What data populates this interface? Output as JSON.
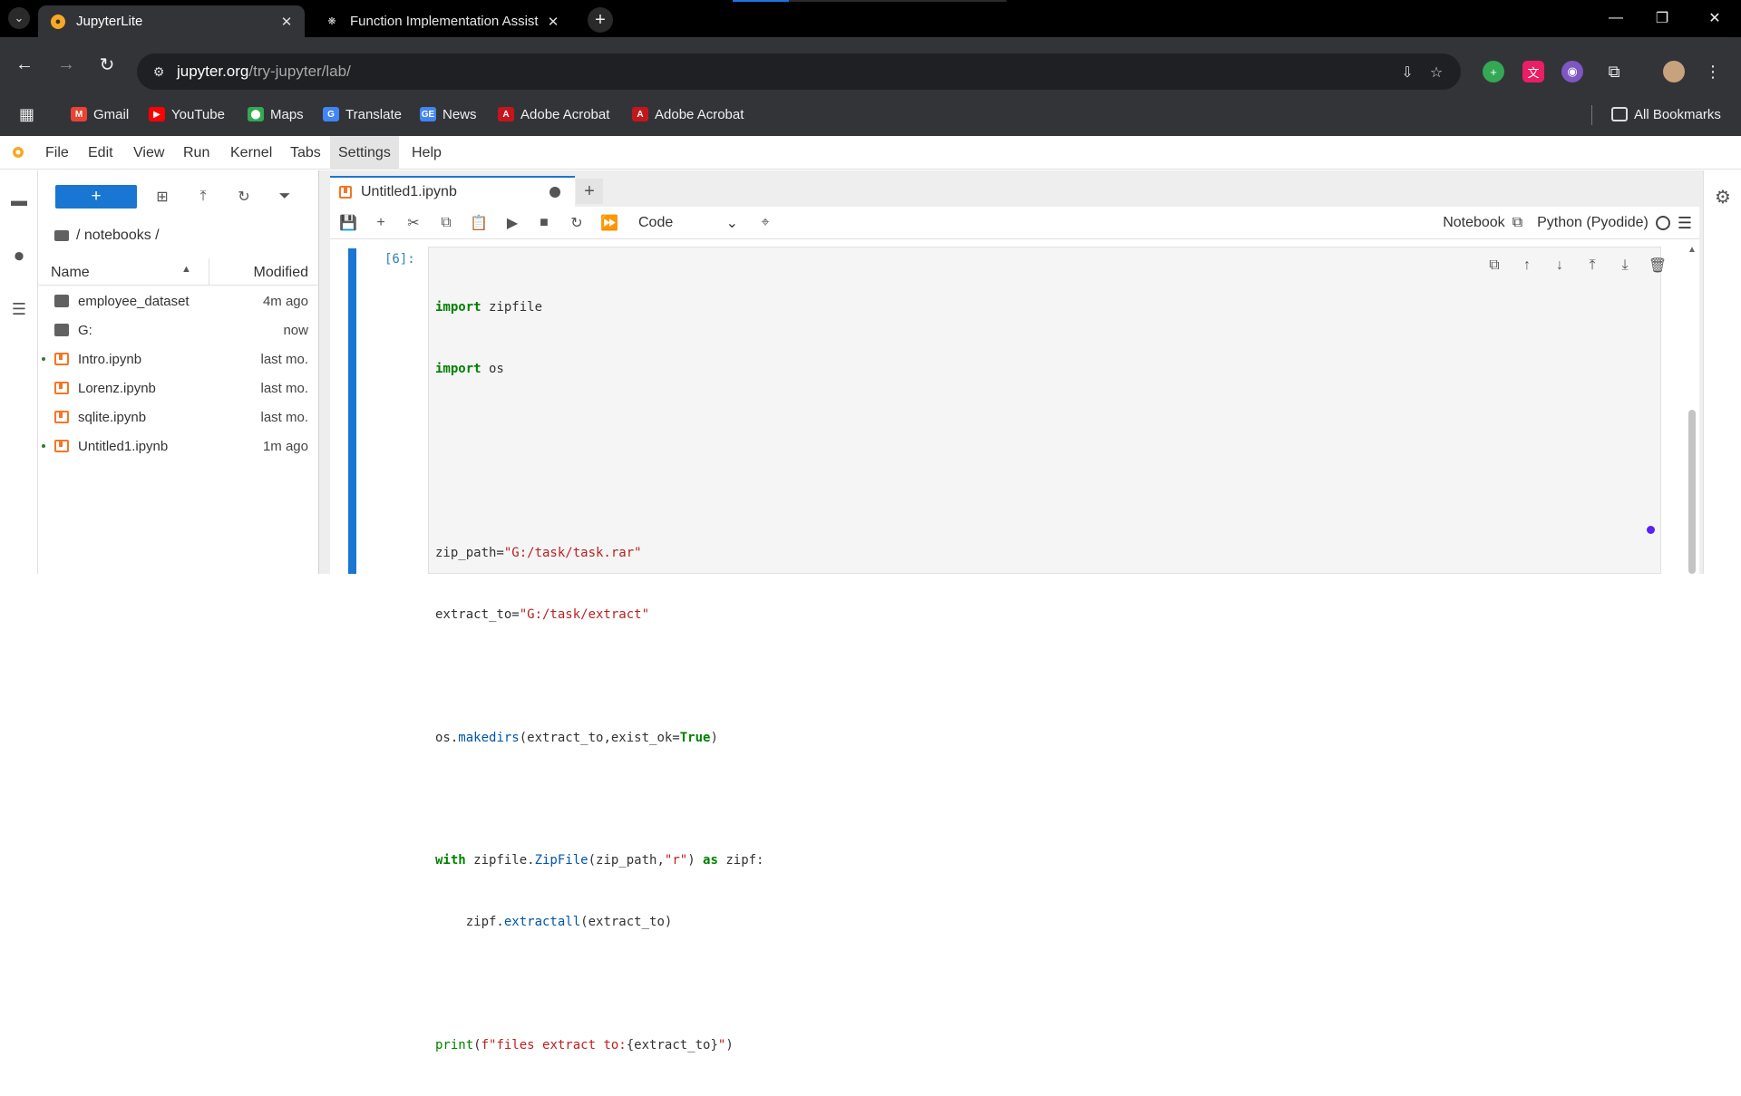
{
  "browser": {
    "tabs": [
      {
        "title": "JupyterLite",
        "active": true
      },
      {
        "title": "Function Implementation Assist",
        "active": false
      }
    ],
    "url_host": "jupyter.org",
    "url_path": "/try-jupyter/lab/",
    "bookmarks": [
      {
        "label": "Gmail",
        "color": "#ea4335"
      },
      {
        "label": "YouTube",
        "color": "#ff0000"
      },
      {
        "label": "Maps",
        "color": "#34a853"
      },
      {
        "label": "Translate",
        "color": "#4285f4"
      },
      {
        "label": "News",
        "color": "#4285f4"
      },
      {
        "label": "Adobe Acrobat",
        "color": "#c4161c"
      },
      {
        "label": "Adobe Acrobat",
        "color": "#c4161c"
      }
    ],
    "all_bookmarks": "All Bookmarks"
  },
  "jupyter": {
    "menu": [
      "File",
      "Edit",
      "View",
      "Run",
      "Kernel",
      "Tabs",
      "Settings",
      "Help"
    ],
    "active_menu": "Settings",
    "filebrowser": {
      "new_label": "+",
      "breadcrumb": "/ notebooks /",
      "col_name": "Name",
      "col_modified": "Modified",
      "files": [
        {
          "name": "employee_dataset",
          "modified": "4m ago",
          "type": "folder",
          "running": false
        },
        {
          "name": "G:",
          "modified": "now",
          "type": "folder",
          "running": false
        },
        {
          "name": "Intro.ipynb",
          "modified": "last mo.",
          "type": "notebook",
          "running": true
        },
        {
          "name": "Lorenz.ipynb",
          "modified": "last mo.",
          "type": "notebook",
          "running": false
        },
        {
          "name": "sqlite.ipynb",
          "modified": "last mo.",
          "type": "notebook",
          "running": false
        },
        {
          "name": "Untitled1.ipynb",
          "modified": "1m ago",
          "type": "notebook",
          "running": true
        }
      ]
    },
    "notebook": {
      "tab_title": "Untitled1.ipynb",
      "cell_type": "Code",
      "notebook_label": "Notebook",
      "kernel_name": "Python (Pyodide)",
      "prompt": "[6]:",
      "code_lines": [
        "import zipfile",
        "import os",
        "",
        "",
        "zip_path=\"G:/task/task.rar\"",
        "extract_to=\"G:/task/extract\"",
        "",
        "os.makedirs(extract_to,exist_ok=True)",
        "",
        "with zipfile.ZipFile(zip_path,\"r\") as zipf:",
        "    zipf.extractall(extract_to)",
        "",
        "print(f\"files extract to:{extract_to}\")"
      ]
    }
  },
  "colors": {
    "accent": "#1976d2",
    "notebook_icon": "#f37726",
    "keyword": "#008000",
    "string": "#ba2121"
  }
}
